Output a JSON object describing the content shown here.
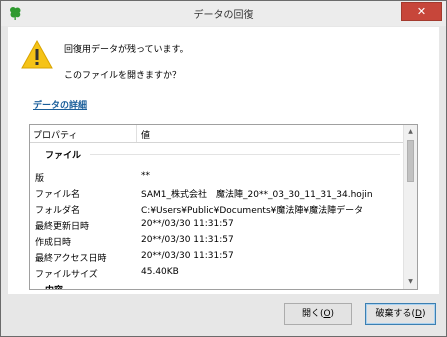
{
  "window": {
    "title": "データの回復",
    "close_label": "✕"
  },
  "message": {
    "line1": "回復用データが残っています。",
    "line2": "このファイルを開きますか？"
  },
  "details_link": "データの詳細",
  "properties": {
    "header_property": "プロパティ",
    "header_value": "値",
    "group_file": "ファイル",
    "rows": [
      {
        "label": "版",
        "value": "**"
      },
      {
        "label": "ファイル名",
        "value": "SAM1_株式会社　魔法陣_20**_03_30_11_31_34.hojin"
      },
      {
        "label": "フォルダ名",
        "value": "C:¥Users¥Public¥Documents¥魔法陣¥魔法陣データ"
      },
      {
        "label": "最終更新日時",
        "value": "20**/03/30 11:31:57"
      },
      {
        "label": "作成日時",
        "value": "20**/03/30 11:31:57"
      },
      {
        "label": "最終アクセス日時",
        "value": "20**/03/30 11:31:57"
      },
      {
        "label": "ファイルサイズ",
        "value": "45.40KB"
      }
    ],
    "group_content": "内容"
  },
  "buttons": {
    "open_label": "開く(",
    "open_key": "O",
    "open_close": ")",
    "discard_label": "破棄する(",
    "discard_key": "D",
    "discard_close": ")"
  }
}
